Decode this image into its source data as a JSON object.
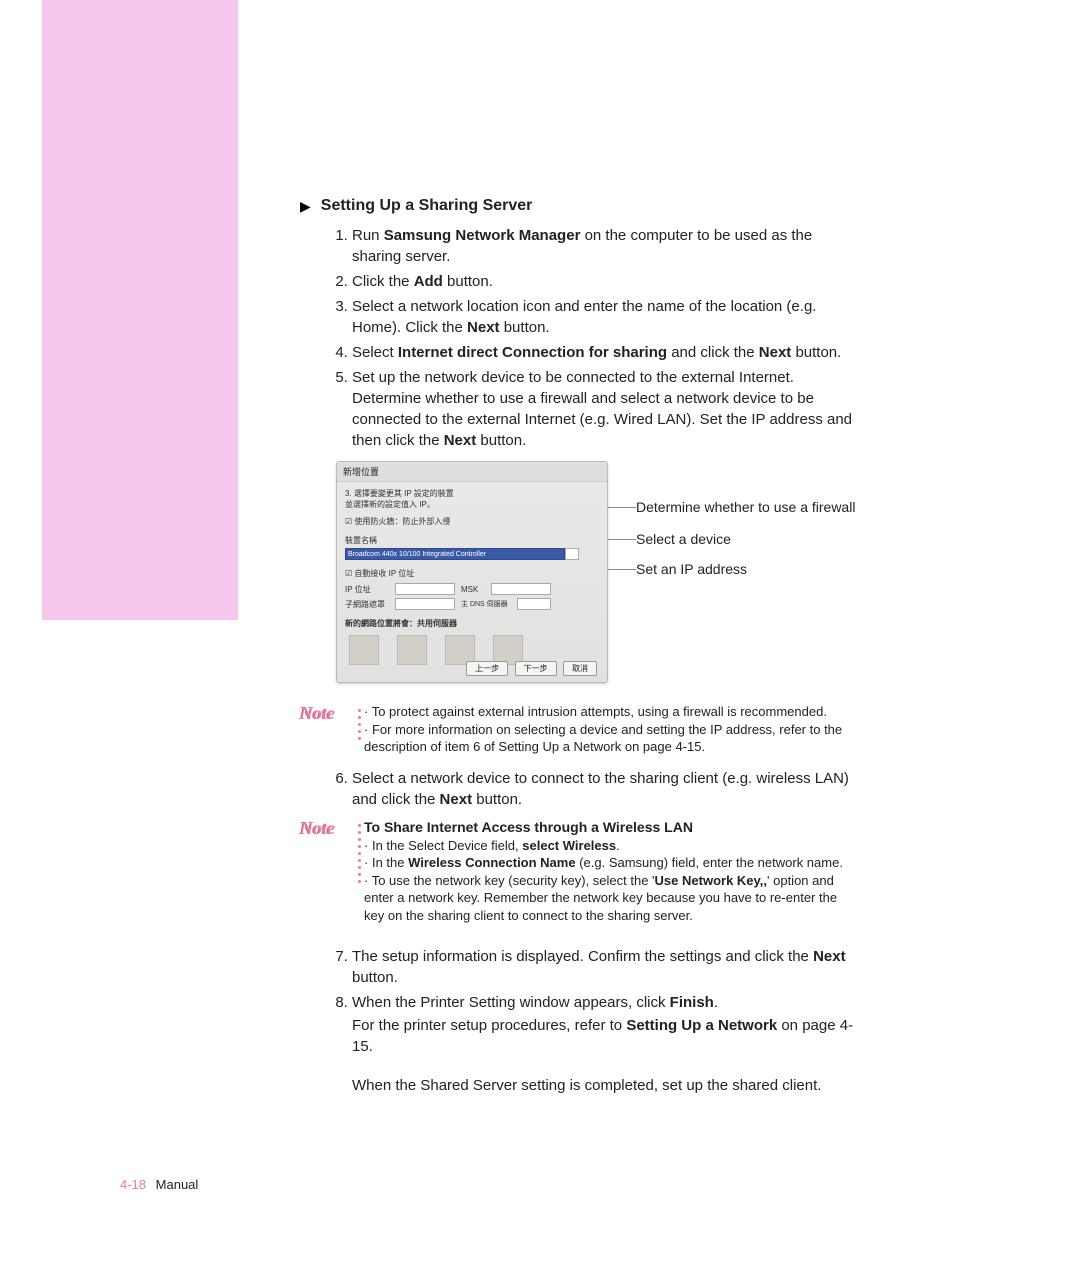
{
  "heading": "Setting Up a Sharing Server",
  "steps": {
    "s1_a": "Run ",
    "s1_b": "Samsung Network Manager",
    "s1_c": " on the computer to be used as the sharing server.",
    "s2_a": "Click the ",
    "s2_b": "Add",
    "s2_c": " button.",
    "s3_a": "Select a network location icon and enter the name of the location (e.g. Home). Click the ",
    "s3_b": "Next",
    "s3_c": " button.",
    "s4_a": "Select ",
    "s4_b": "Internet direct Connection for sharing",
    "s4_c": " and click the ",
    "s4_d": "Next",
    "s4_e": " button.",
    "s5_a": "Set up the network device to be connected to the external Internet. Determine whether to use a firewall and select a network device to be connected to the external Internet (e.g. Wired LAN). Set the IP address and then click the ",
    "s5_b": "Next",
    "s5_c": " button.",
    "s6_a": "Select a network device to connect to the sharing client (e.g. wireless LAN) and click the ",
    "s6_b": "Next",
    "s6_c": " button.",
    "s7_a": "The setup information is displayed. Confirm the settings and click the ",
    "s7_b": "Next",
    "s7_c": " button.",
    "s8_a": "When the Printer Setting window appears, click ",
    "s8_b": "Finish",
    "s8_c": ".",
    "s8_follow_a": "For the printer setup procedures, refer to ",
    "s8_follow_b": "Setting Up a Network",
    "s8_follow_c": " on page 4-15.",
    "final": "When the Shared Server setting is completed, set up the shared client."
  },
  "callouts": {
    "c1": "Determine whether to use a firewall",
    "c2": "Select a device",
    "c3": "Set an IP address"
  },
  "dialog": {
    "title": "新增位置",
    "line1": "3. 選擇要變更其 IP 設定的裝置",
    "line2": "並選擇新的設定值入 IP。",
    "firewall": "使用防火牆：防止外部入侵",
    "deviceLabel": "裝置名稱",
    "deviceValue": "Broadcom 440x 10/100 Integrated Controller",
    "autoip": "自動接收 IP 位址",
    "ip": "IP 位址",
    "mask": "MSK",
    "subnet": "子網路遮罩",
    "dns": "主 DNS 伺服器",
    "thumbHeader": "新的網路位置將會：共用伺服器",
    "btnPrev": "上一步",
    "btnNext": "下一步",
    "btnCancel": "取消"
  },
  "note1": {
    "l1": "To protect against external intrusion attempts, using a firewall is recommended.",
    "l2": "For more information on selecting a device and setting the IP address, refer to the description of item 6 of Setting Up a Network on page 4-15."
  },
  "note2": {
    "title": "To Share Internet Access through a Wireless LAN",
    "b1_a": "In the Select Device field, ",
    "b1_b": "select Wireless",
    "b1_c": ".",
    "b2_a": "In the ",
    "b2_b": "Wireless Connection Name",
    "b2_c": " (e.g. Samsung) field, enter the network name.",
    "b3_a": "To use the network key (security key), select the '",
    "b3_b": "Use Network Key,,",
    "b3_c": "' option and enter a network key. Remember the network key because you have to re-enter the key on the sharing client to connect to the sharing server."
  },
  "noteLabel": "Note",
  "footer": {
    "page": "4-18",
    "label": "Manual"
  }
}
